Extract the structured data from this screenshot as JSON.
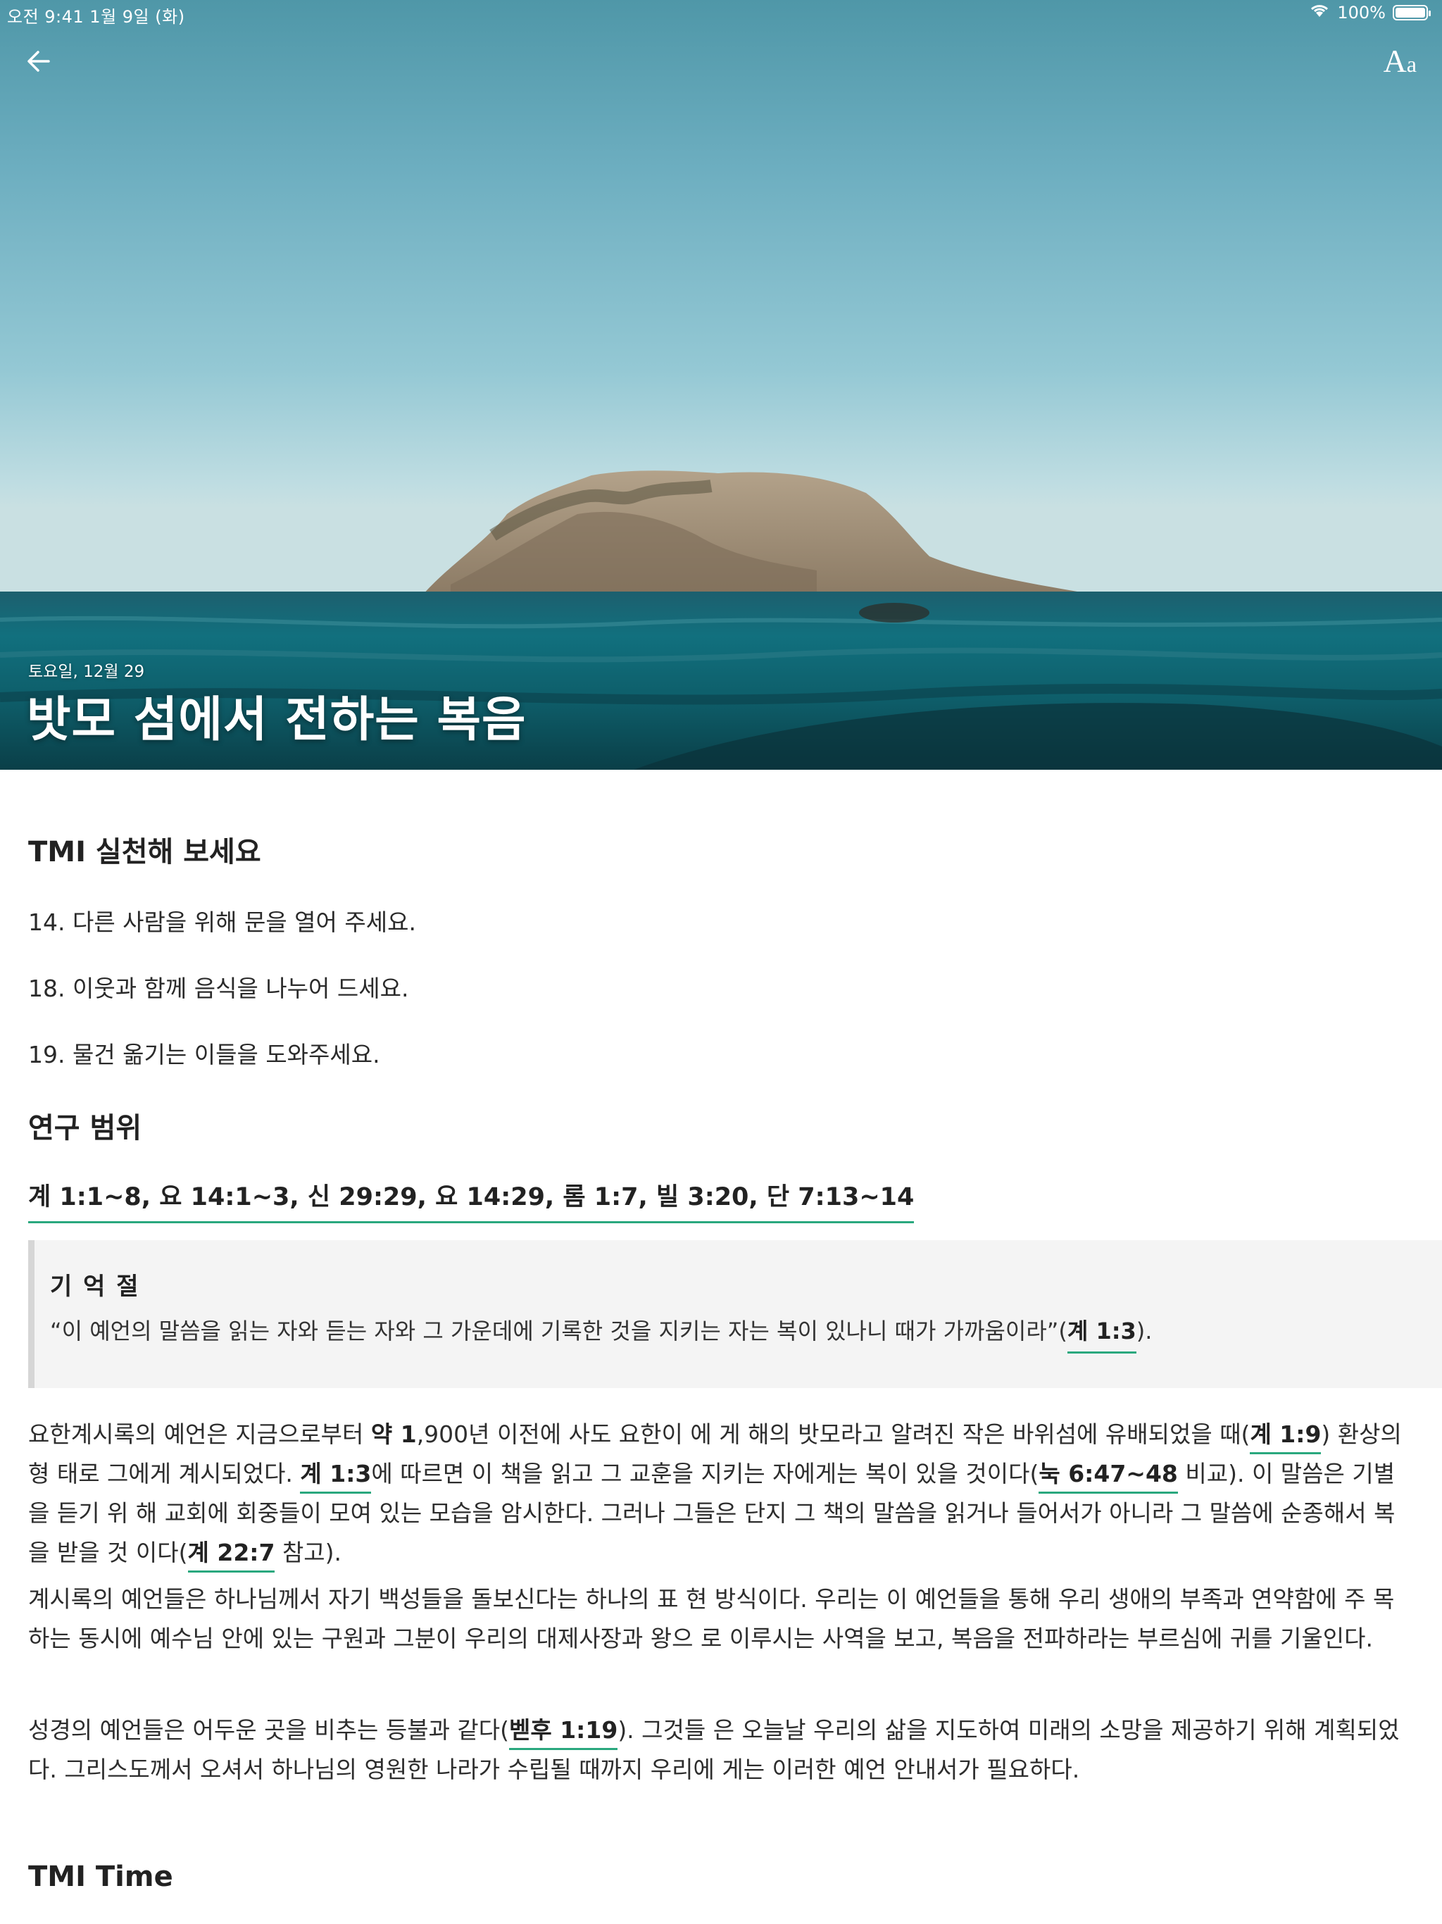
{
  "status": {
    "time": "오전 9:41   1월 9일 (화)",
    "battery": "100%"
  },
  "hero": {
    "date": "토요일, 12월 29",
    "title": "밧모 섬에서 전하는 복음"
  },
  "toolbar": {
    "font_big": "A",
    "font_small": "a"
  },
  "sections": {
    "tmi_title": "TMI 실천해 보세요",
    "tmi_items": [
      "14. 다른 사람을 위해 문을 열어 주세요.",
      "18. 이웃과 함께 음식을 나누어 드세요.",
      "19. 물건 옮기는 이들을 도와주세요."
    ],
    "range_title": "연구 범위",
    "range_refs": "계 1:1~8, 요 14:1~3, 신 29:29, 요 14:29, 롬 1:7, 빌 3:20, 단 7:13~14",
    "memory_title": "기 억 절",
    "memory_text": "“이 예언의 말씀을 읽는 자와 듣는 자와 그 가운데에 기록한 것을 지키는 자는 복이 있나니 때가 가까움이라”(",
    "memory_ref": "계 1:3",
    "memory_end": ").",
    "p1": {
      "a": "요한계시록의 예언은 지금으로부터 ",
      "b": "약 1",
      "c": ",900년 이전에 사도 요한이 에 게 해의 밧모라고 알려진 작은 바위섬에 유배되었을 때(",
      "ref1": "계 1:9",
      "d": ") 환상의 형 태로 그에게 계시되었다. ",
      "ref2": "계 1:3",
      "e": "에 따르면 이 책을 읽고 그 교훈을 지키는 자에게는 복이 있을 것이다(",
      "ref3": "눅 6:47~48",
      "f": " 비교). 이 말씀은 기별을 듣기 위 해 교회에 회중들이 모여 있는 모습을 암시한다. 그러나 그들은 단지 그 책의 말씀을 읽거나 들어서가 아니라 그 말씀에 순종해서 복을 받을 것 이다(",
      "ref4": "계 22:7",
      "g": " 참고)."
    },
    "p2": "계시록의 예언들은 하나님께서 자기 백성들을 돌보신다는 하나의 표 현 방식이다. 우리는 이 예언들을 통해 우리 생애의 부족과 연약함에 주 목하는 동시에 예수님 안에 있는 구원과 그분이 우리의 대제사장과 왕으 로 이루시는 사역을 보고, 복음을 전파하라는 부르심에 귀를 기울인다.",
    "p3": {
      "a": "성경의 예언들은 어두운 곳을 비추는 등불과 같다(",
      "ref1": "벧후 1:19",
      "b": "). 그것들 은 오늘날 우리의 삶을 지도하여 미래의 소망을 제공하기 위해 계획되었 다. 그리스도께서 오셔서 하나님의 영원한 나라가 수립될 때까지 우리에 게는 이러한 예언 안내서가 필요하다."
    },
    "time_title": "TMI Time"
  }
}
